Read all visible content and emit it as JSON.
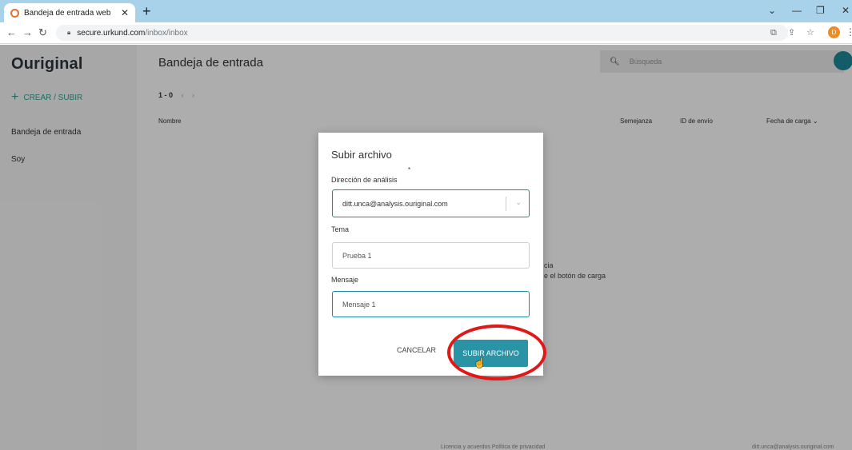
{
  "browser": {
    "tab_title": "Bandeja de entrada web",
    "url_host": "secure.urkund.com",
    "url_path": "/inbox/inbox",
    "profile_initial": "D"
  },
  "app": {
    "logo": "Ouriginal",
    "create_label": "CREAR / SUBIR",
    "sidebar": [
      "Bandeja de entrada",
      "Soy"
    ],
    "page_title": "Bandeja de entrada",
    "search_placeholder": "Búsqueda",
    "pager": "1 - 0",
    "columns": {
      "name": "Nombre",
      "similarity": "Semejanza",
      "submission_id": "ID de envío",
      "upload_date": "Fecha de carga"
    },
    "empty_line1": "cia",
    "empty_line2": "e el botón de carga",
    "footer_links": "Licencia y acuerdos   Política de privacidad",
    "footer_email": "ditt.unca@analysis.ouriginal.com"
  },
  "modal": {
    "title": "Subir archivo",
    "address_label": "Dirección de análisis",
    "address_value": "ditt.unca@analysis.ouriginal.com",
    "subject_label": "Tema",
    "subject_value": "Prueba 1",
    "message_label": "Mensaje",
    "message_value": "Mensaje 1",
    "cancel_label": "CANCELAR",
    "upload_label": "SUBIR ARCHIVO"
  },
  "colors": {
    "accent": "#2a93a6",
    "highlight": "#e01818",
    "tab_bar": "#a8d2ea"
  }
}
